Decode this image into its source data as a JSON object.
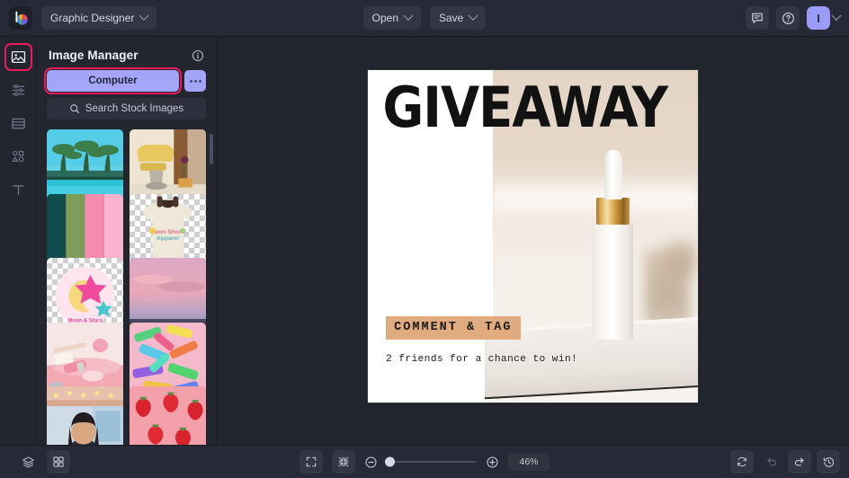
{
  "app": {
    "brand_logo": "colorful-circle-logo",
    "workspace_label": "Graphic Designer"
  },
  "topbar": {
    "open_label": "Open",
    "save_label": "Save",
    "feedback_icon": "chat-bubble-icon",
    "help_icon": "question-circle-icon",
    "avatar_initial": "I"
  },
  "rail": {
    "items": [
      {
        "name": "images",
        "icon": "image-icon",
        "selected": true
      },
      {
        "name": "adjust",
        "icon": "sliders-icon",
        "selected": false
      },
      {
        "name": "layout",
        "icon": "layout-icon",
        "selected": false
      },
      {
        "name": "elements",
        "icon": "shapes-icon",
        "selected": false
      },
      {
        "name": "text",
        "icon": "text-t-icon",
        "selected": false
      }
    ]
  },
  "panel": {
    "title": "Image Manager",
    "info_icon": "info-circle-icon",
    "computer_label": "Computer",
    "more_label": "more-options",
    "search_label": "Search Stock Images",
    "search_icon": "search-icon",
    "thumbnails": [
      {
        "alt": "tropical pool with palm trees",
        "kind": "photo-palms"
      },
      {
        "alt": "yellow stand mixer on counter",
        "kind": "photo-mixer"
      },
      {
        "alt": "color palette swatch strips",
        "kind": "swatch-strips"
      },
      {
        "alt": "cream t-shirt with apparel logo",
        "kind": "png-tshirt"
      },
      {
        "alt": "pink moon and stars sticker",
        "kind": "png-sticker"
      },
      {
        "alt": "pink sunset clouds over city",
        "kind": "photo-sunset"
      },
      {
        "alt": "pink cosmetics flatlay",
        "kind": "photo-cosmetics"
      },
      {
        "alt": "colorful plastic toy water guns",
        "kind": "photo-toys"
      },
      {
        "alt": "person at arcade claw machine",
        "kind": "photo-arcade"
      },
      {
        "alt": "strawberries on pink background",
        "kind": "photo-strawberries"
      }
    ]
  },
  "artboard": {
    "title": "GIVEAWAY",
    "tag": "COMMENT & TAG",
    "subtitle": "2 friends for a chance to win!",
    "tag_bg_color": "#e0ab7f",
    "photo_alt": "white dropper bottle with gold collar on marble slab"
  },
  "bottombar": {
    "layers_icon": "layers-icon",
    "pages_icon": "grid-pages-icon",
    "fit_icon": "fit-to-screen-icon",
    "shrink_icon": "shrink-to-fit-icon",
    "zoom_out_icon": "minus-circle-icon",
    "zoom_in_icon": "plus-circle-icon",
    "zoom_value": "46%",
    "zoom_slider_percent": 0,
    "reset_icon": "reset-rotate-icon",
    "undo_icon": "undo-arrow-icon",
    "redo_icon": "redo-arrow-icon",
    "history_icon": "history-clock-icon"
  }
}
